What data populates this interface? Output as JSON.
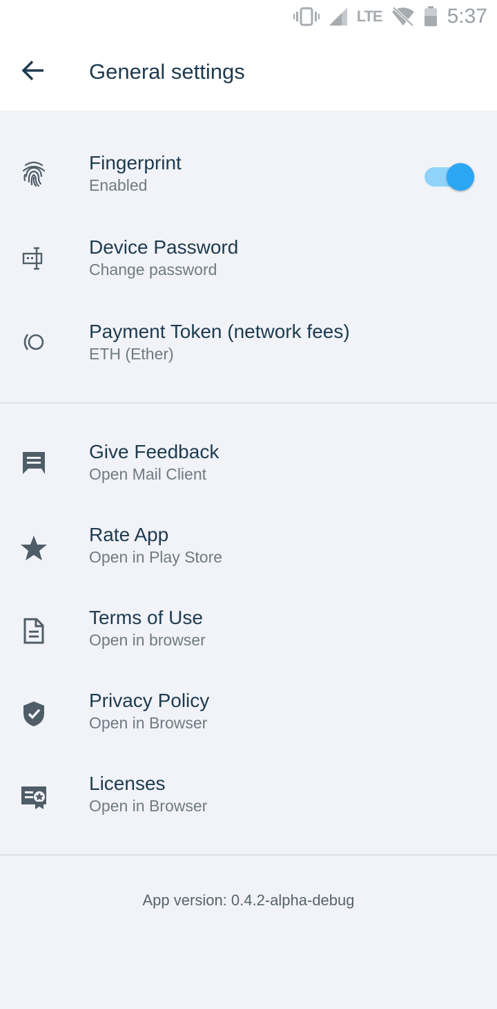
{
  "status_bar": {
    "network": "LTE",
    "time": "5:37",
    "icons": [
      "vibrate-icon",
      "signal-icon",
      "wifi-off-icon",
      "battery-icon"
    ]
  },
  "header": {
    "back_icon": "back-arrow-icon",
    "title": "General settings"
  },
  "security_section": [
    {
      "icon": "fingerprint-icon",
      "title": "Fingerprint",
      "subtitle": "Enabled",
      "toggle_on": true
    },
    {
      "icon": "password-icon",
      "title": "Device Password",
      "subtitle": "Change password"
    },
    {
      "icon": "token-icon",
      "title": "Payment Token (network fees)",
      "subtitle": "ETH (Ether)"
    }
  ],
  "info_section": [
    {
      "icon": "feedback-icon",
      "title": "Give Feedback",
      "subtitle": "Open Mail Client"
    },
    {
      "icon": "star-icon",
      "title": "Rate App",
      "subtitle": "Open in Play Store"
    },
    {
      "icon": "document-icon",
      "title": "Terms of Use",
      "subtitle": "Open in browser"
    },
    {
      "icon": "shield-icon",
      "title": "Privacy Policy",
      "subtitle": "Open in Browser"
    },
    {
      "icon": "license-icon",
      "title": "Licenses",
      "subtitle": "Open in Browser"
    }
  ],
  "footer": {
    "version": "App version: 0.4.2-alpha-debug"
  },
  "colors": {
    "background": "#f1f3f8",
    "surface": "#ffffff",
    "text_primary": "#1d3a4e",
    "text_secondary": "#6f7a82",
    "icon": "#4f5d68",
    "toggle_knob": "#2aa6f3",
    "toggle_track": "#8fd3fb"
  }
}
